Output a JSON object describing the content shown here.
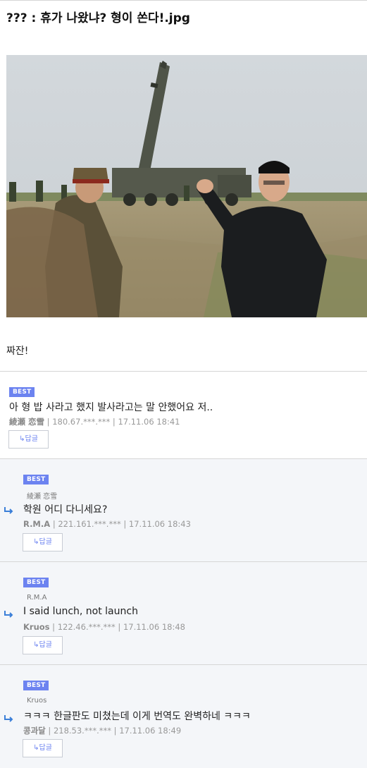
{
  "post": {
    "title": "??? : 휴가 나왔냐? 형이 쏜다!.jpg",
    "body": "짜잔!"
  },
  "comments": [
    {
      "badge": "BEST",
      "text": "아 형 밥 사라고 했지 발사라고는 말 안했어요 저..",
      "author": "綾瀬 恋雪",
      "ip": "180.67.***.***",
      "date": "17.11.06 18:41",
      "reply_label": "↳답글"
    },
    {
      "badge": "BEST",
      "reply_to": "綾瀬 恋雪",
      "text": "학원 어디 다니세요?",
      "author": "R.M.A",
      "ip": "221.161.***.***",
      "date": "17.11.06 18:43",
      "reply_label": "↳답글"
    },
    {
      "badge": "BEST",
      "reply_to": "R.M.A",
      "text": "I said lunch, not launch",
      "author": "Kruos",
      "ip": "122.46.***.***",
      "date": "17.11.06 18:48",
      "reply_label": "↳답글"
    },
    {
      "badge": "BEST",
      "reply_to": "Kruos",
      "text": "ㅋㅋㅋ 한글판도 미쳤는데 이게 번역도 완벽하네 ㅋㅋㅋ",
      "author": "콩과달",
      "ip": "218.53.***.***",
      "date": "17.11.06 18:49",
      "reply_label": "↳답글"
    }
  ],
  "separator": "|",
  "colors": {
    "badge": "#6c83f0",
    "reply_arrow": "#3b7fd8",
    "reply_background": "#f4f6f9"
  }
}
